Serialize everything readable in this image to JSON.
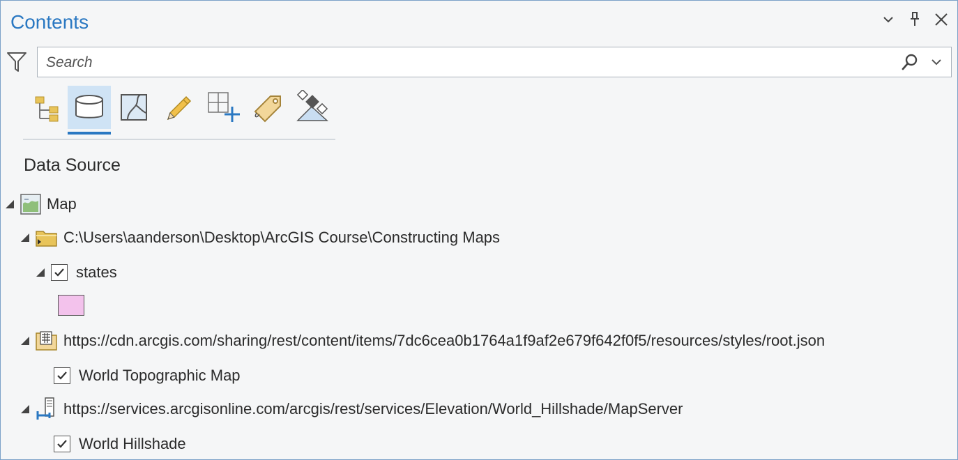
{
  "pane": {
    "title": "Contents",
    "controls": [
      "dropdown",
      "pin",
      "close"
    ]
  },
  "search": {
    "placeholder": "Search"
  },
  "toolbar": {
    "buttons": [
      {
        "name": "list-by-drawing-order",
        "icon": "drawing-order-icon",
        "active": false
      },
      {
        "name": "list-by-data-source",
        "icon": "database-icon",
        "active": true
      },
      {
        "name": "list-by-selection",
        "icon": "map-selection-icon",
        "active": false
      },
      {
        "name": "list-by-editing",
        "icon": "pencil-icon",
        "active": false
      },
      {
        "name": "list-by-snapping",
        "icon": "grid-add-icon",
        "active": false
      },
      {
        "name": "list-by-labeling",
        "icon": "tag-icon",
        "active": false
      },
      {
        "name": "list-by-perspective-imagery",
        "icon": "satellite-icon",
        "active": false
      }
    ]
  },
  "section_title": "Data Source",
  "tree": {
    "map": "Map",
    "folder": "C:\\Users\\aanderson\\Desktop\\ArcGIS Course\\Constructing Maps",
    "states": {
      "label": "states",
      "checked": true,
      "fill": "#f3c2ec"
    },
    "vector_source": "https://cdn.arcgis.com/sharing/rest/content/items/7dc6cea0b1764a1f9af2e679f642f0f5/resources/styles/root.json",
    "topo": {
      "label": "World Topographic Map",
      "checked": true
    },
    "map_server": "https://services.arcgisonline.com/arcgis/rest/services/Elevation/World_Hillshade/MapServer",
    "hillshade": {
      "label": "World Hillshade",
      "checked": true
    }
  },
  "colors": {
    "accent": "#2a78c2",
    "active_tab_bg": "#cfe3f5",
    "pane_bg": "#f5f6f7"
  }
}
